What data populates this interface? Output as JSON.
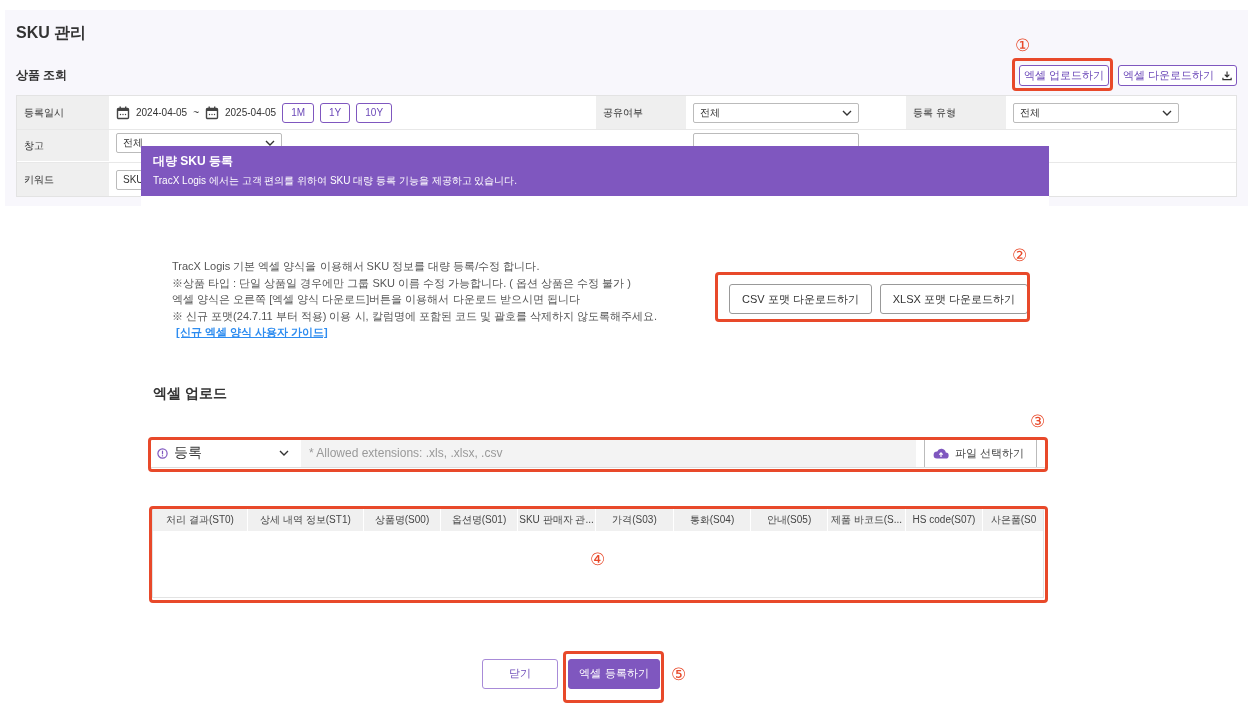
{
  "page": {
    "title": "SKU 관리",
    "section_title": "상품 조회",
    "header_buttons": [
      {
        "label": "엑셀 업로드하기",
        "kind": "plain"
      },
      {
        "label": "엑셀 다운로드하기",
        "kind": "download"
      }
    ],
    "filter_rows": [
      [
        {
          "kind": "label",
          "text": "등록일시"
        },
        {
          "kind": "date_range",
          "start": "2024-04-05",
          "separator": "~",
          "end": "2025-04-05",
          "presets": [
            "1M",
            "1Y",
            "10Y"
          ]
        },
        {
          "kind": "label",
          "text": "공유여부"
        },
        {
          "kind": "select",
          "value": "전체"
        },
        {
          "kind": "label",
          "text": "등록 유형"
        },
        {
          "kind": "select",
          "value": "전체"
        }
      ],
      [
        {
          "kind": "label",
          "text": "창고"
        },
        {
          "kind": "select",
          "value": "전체"
        },
        {
          "kind": "covered_label"
        },
        {
          "kind": "covered_select"
        }
      ],
      [
        {
          "kind": "label",
          "text": "키워드"
        },
        {
          "kind": "text_input",
          "value": "SKU"
        }
      ]
    ]
  },
  "modal": {
    "title": "대량 SKU 등록",
    "subtitle": "TracX Logis 에서는 고객 편의를 위하여 SKU 대량 등록 기능을 제공하고 있습니다.",
    "notes": [
      {
        "text": "TracX Logis 기본 엑셀 양식을 이용해서 SKU 정보를 대량 등록/수정 합니다."
      },
      {
        "text": "※상품 타입 : 단일 상품일 경우에만 그룹 SKU 이름 수정 가능합니다. ( 옵션 상품은 수정 불가 )"
      },
      {
        "text": "엑셀 양식은 오른쪽 [엑셀 양식 다운로드]버튼을 이용해서 다운로드 받으시면 됩니다"
      },
      {
        "text": "※ 신규 포맷(24.7.11 부터 적용) 이용 시, 칼럼명에 포함된 코드 및 괄호를 삭제하지 않도록해주세요.",
        "link": "[신규 엑셀 양식 사용자 가이드]"
      }
    ],
    "format_buttons": [
      "CSV 포맷 다운로드하기",
      "XLSX 포맷 다운로드하기"
    ],
    "upload_title": "엑셀 업로드",
    "upload": {
      "mode": "등록",
      "placeholder": "* Allowed extensions: .xls, .xlsx, .csv",
      "button": "파일 선택하기"
    },
    "table": {
      "columns": [
        "처리 결과(ST0)",
        "상세 내역 정보(ST1)",
        "상품명(S00)",
        "옵션명(S01)",
        "SKU 판매자 관...",
        "가격(S03)",
        "통화(S04)",
        "안내(S05)",
        "제품 바코드(S...",
        "HS code(S07)",
        "사은품(S0"
      ]
    },
    "footer_buttons": [
      {
        "label": "닫기",
        "kind": "secondary"
      },
      {
        "label": "엑셀 등록하기",
        "kind": "primary"
      }
    ]
  },
  "annotations": [
    {
      "number": "①"
    },
    {
      "number": "②"
    },
    {
      "number": "③"
    },
    {
      "number": "④"
    },
    {
      "number": "⑤"
    }
  ]
}
